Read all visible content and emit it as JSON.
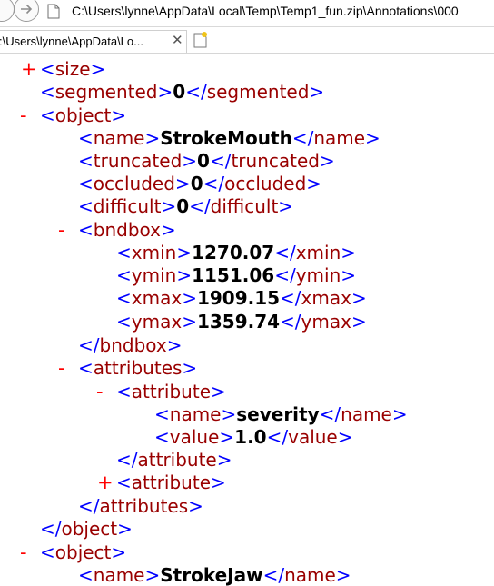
{
  "browser": {
    "url": "C:\\Users\\lynne\\AppData\\Local\\Temp\\Temp1_fun.zip\\Annotations\\000",
    "tab_title": ":\\Users\\lynne\\AppData\\Lo...",
    "tab_close": "✕"
  },
  "xml": {
    "expanded_symbol": "-",
    "collapsed_symbol": "+",
    "tags": {
      "size": "size",
      "segmented": "segmented",
      "object": "object",
      "name": "name",
      "truncated": "truncated",
      "occluded": "occluded",
      "difficult": "difficult",
      "bndbox": "bndbox",
      "xmin": "xmin",
      "ymin": "ymin",
      "xmax": "xmax",
      "ymax": "ymax",
      "attributes": "attributes",
      "attribute": "attribute",
      "value": "value"
    },
    "values": {
      "segmented": "0",
      "object_name": "StrokeMouth",
      "truncated": "0",
      "occluded": "0",
      "difficult": "0",
      "xmin": "1270.07",
      "ymin": "1151.06",
      "xmax": "1909.15",
      "ymax": "1359.74",
      "attribute_name": "severity",
      "attribute_value": "1.0",
      "next_object_name": "StrokeJaw"
    }
  }
}
